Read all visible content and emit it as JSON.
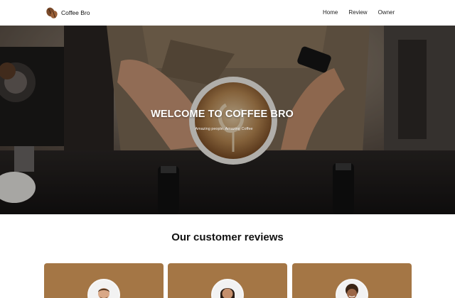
{
  "nav": {
    "brand": "Coffee Bro",
    "links": [
      {
        "label": "Home"
      },
      {
        "label": "Review"
      },
      {
        "label": "Owner"
      }
    ]
  },
  "hero": {
    "title": "WELCOME TO COFFEE BRO",
    "subtitle": "Amazing people. Amazing Coffee"
  },
  "reviews": {
    "title": "Our customer reviews"
  },
  "colors": {
    "card": "#a47645",
    "brand_bean": "#7a4a2a"
  },
  "icons": [
    "coffee-beans-icon"
  ]
}
